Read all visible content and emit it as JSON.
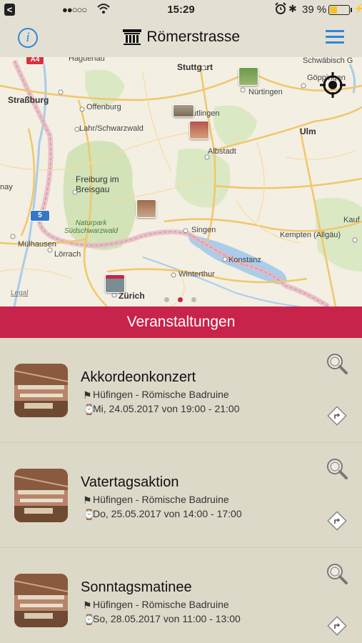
{
  "status_bar": {
    "time": "15:29",
    "signal": "●●○○○",
    "battery_percent": "39 %",
    "battery_level": 0.39,
    "battery_color": "#f5c12c"
  },
  "nav": {
    "title": "Römerstrasse",
    "info_icon": "info-icon",
    "menu_icon": "hamburger-menu-icon",
    "accent": "#2e86d6"
  },
  "map": {
    "labels": {
      "haguenau": "Haguenau",
      "stuttgart": "Stuttgart",
      "schwaebisch": "Schwäbisch G",
      "goeppingen": "Göppingen",
      "strassburg": "Straßburg",
      "offenburg": "Offenburg",
      "nuertingen": "Nürtingen",
      "reutlingen": "utlingen",
      "lahr": "Lahr/Schwarzwald",
      "ulm": "Ulm",
      "albstadt": "Albstadt",
      "freiburg": "Freiburg im\nBreisgau",
      "nay": "nay",
      "naturpark": "Naturpark\nSüdschwarzwald",
      "singen": "Singen",
      "kauf": "Kauf",
      "kempten": "Kempten (Allgäu)",
      "muelhausen": "Mülhausen",
      "loerrach": "Lörrach",
      "konstanz": "Konstanz",
      "winterthur": "Winterthur",
      "zuerich": "Zürich",
      "legal": "Legal",
      "a4": "A4",
      "five": "5"
    },
    "page_count": 3,
    "active_page": 1
  },
  "section_title": "Veranstaltungen",
  "section_color": "#c8234a",
  "events": [
    {
      "title": "Akkordeonkonzert",
      "location": "Hüfingen - Römische Badruine",
      "datetime": "Mi, 24.05.2017 von 19:00 - 21:00"
    },
    {
      "title": "Vatertagsaktion",
      "location": "Hüfingen - Römische Badruine",
      "datetime": "Do, 25.05.2017 von 14:00 - 17:00"
    },
    {
      "title": "Sonntagsmatinee",
      "location": "Hüfingen - Römische Badruine",
      "datetime": "So, 28.05.2017 von 11:00 - 13:00"
    }
  ]
}
